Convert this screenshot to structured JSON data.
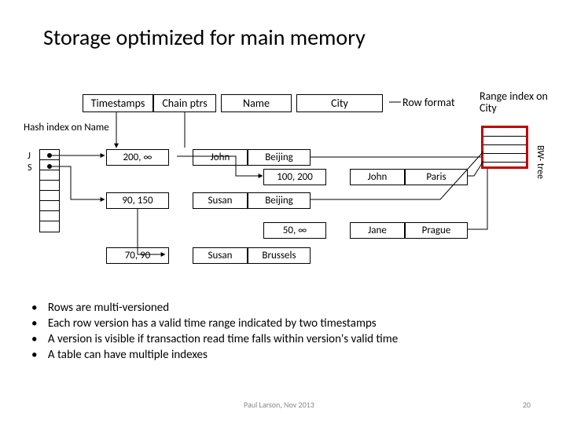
{
  "title": "Storage optimized for main memory",
  "headers": {
    "ts": "Timestamps",
    "cp": "Chain ptrs",
    "nm": "Name",
    "ct": "City"
  },
  "row_format_label": "Row format",
  "range_index_label": "Range index on City",
  "hash_index_label": "Hash index on Name",
  "bucket_labels": {
    "j": "J",
    "s": "S"
  },
  "records": {
    "r1": {
      "ts": "200, ∞",
      "nm": "John",
      "ct": "Beijing"
    },
    "r2": {
      "ts": "100, 200",
      "nm": "John",
      "ct": "Paris"
    },
    "r3": {
      "ts": "90, 150",
      "nm": "Susan",
      "ct": "Beijing"
    },
    "r4": {
      "ts": "50, ∞",
      "nm": "Jane",
      "ct": "Prague"
    },
    "r5": {
      "ts": "70, 90",
      "nm": "Susan",
      "ct": "Brussels"
    }
  },
  "bw_label": "BW- tree",
  "bullets": [
    "Rows are multi-versioned",
    "Each row version has a valid time range indicated by two timestamps",
    "A version is visible if transaction read time falls within version's valid time",
    "A table can have multiple indexes"
  ],
  "citation": "Paul Larson, Nov 2013",
  "page_number": "20"
}
